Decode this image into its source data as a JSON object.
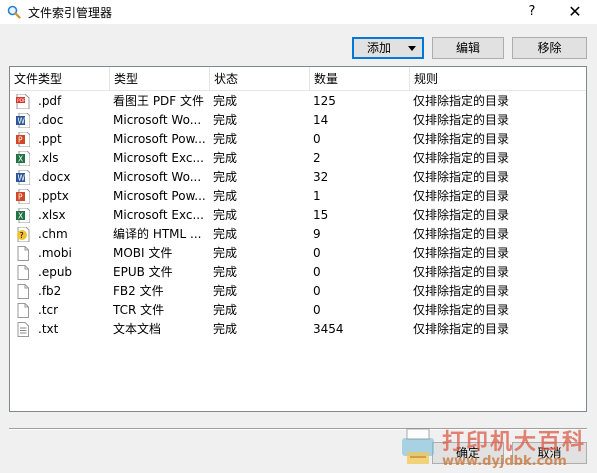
{
  "window": {
    "title": "文件索引管理器",
    "help": "?",
    "close": "✕"
  },
  "toolbar": {
    "add_label": "添加",
    "edit_label": "编辑",
    "delete_label": "移除"
  },
  "list": {
    "columns": [
      "文件类型",
      "类型",
      "状态",
      "数量",
      "规则"
    ],
    "rows": [
      {
        "icon": "pdf-icon",
        "ext": ".pdf",
        "type": "看图王 PDF 文件",
        "status": "完成",
        "count": "125",
        "rule": "仅排除指定的目录"
      },
      {
        "icon": "word-icon",
        "ext": ".doc",
        "type": "Microsoft Wo...",
        "status": "完成",
        "count": "14",
        "rule": "仅排除指定的目录"
      },
      {
        "icon": "powerpoint-icon",
        "ext": ".ppt",
        "type": "Microsoft Pow...",
        "status": "完成",
        "count": "0",
        "rule": "仅排除指定的目录"
      },
      {
        "icon": "excel-icon",
        "ext": ".xls",
        "type": "Microsoft Exc...",
        "status": "完成",
        "count": "2",
        "rule": "仅排除指定的目录"
      },
      {
        "icon": "word-icon",
        "ext": ".docx",
        "type": "Microsoft Wo...",
        "status": "完成",
        "count": "32",
        "rule": "仅排除指定的目录"
      },
      {
        "icon": "powerpoint-icon",
        "ext": ".pptx",
        "type": "Microsoft Pow...",
        "status": "完成",
        "count": "1",
        "rule": "仅排除指定的目录"
      },
      {
        "icon": "excel-icon",
        "ext": ".xlsx",
        "type": "Microsoft Exc...",
        "status": "完成",
        "count": "15",
        "rule": "仅排除指定的目录"
      },
      {
        "icon": "chm-help-icon",
        "ext": ".chm",
        "type": "编译的 HTML ...",
        "status": "完成",
        "count": "9",
        "rule": "仅排除指定的目录"
      },
      {
        "icon": "blank-file-icon",
        "ext": ".mobi",
        "type": "MOBI 文件",
        "status": "完成",
        "count": "0",
        "rule": "仅排除指定的目录"
      },
      {
        "icon": "blank-file-icon",
        "ext": ".epub",
        "type": "EPUB 文件",
        "status": "完成",
        "count": "0",
        "rule": "仅排除指定的目录"
      },
      {
        "icon": "blank-file-icon",
        "ext": ".fb2",
        "type": "FB2 文件",
        "status": "完成",
        "count": "0",
        "rule": "仅排除指定的目录"
      },
      {
        "icon": "blank-file-icon",
        "ext": ".tcr",
        "type": "TCR 文件",
        "status": "完成",
        "count": "0",
        "rule": "仅排除指定的目录"
      },
      {
        "icon": "text-file-icon",
        "ext": ".txt",
        "type": "文本文档",
        "status": "完成",
        "count": "3454",
        "rule": "仅排除指定的目录"
      }
    ]
  },
  "footer": {
    "ok_label": "确定",
    "cancel_label": "取消"
  },
  "watermark": {
    "line1": "打印机大百科",
    "line2": "www.dyjdbk.com"
  },
  "colors": {
    "accent": "#0078d7",
    "pdf": "#d9342b",
    "word": "#2b579a",
    "powerpoint": "#d24726",
    "excel": "#217346"
  }
}
